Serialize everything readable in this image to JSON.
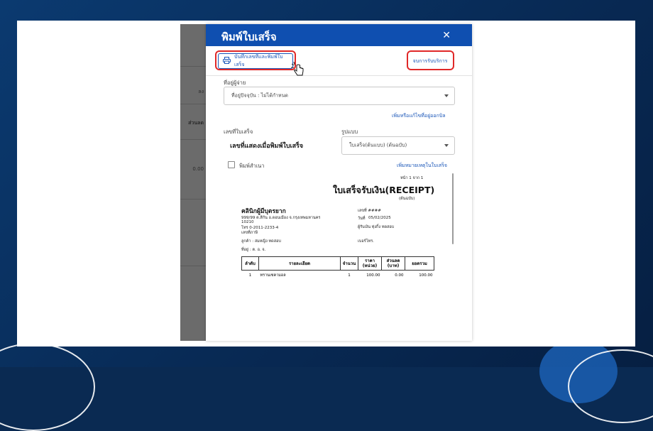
{
  "modal": {
    "title": "พิมพ์ใบเสร็จ",
    "close_icon": "close-icon"
  },
  "toolbar": {
    "save_print_label": "บันทึกเลขที่และพิมพ์ใบเสร็จ",
    "save_print_icon": "printer-icon",
    "end_service_label": "จบการรับบริการ"
  },
  "form": {
    "address_label": "ที่อยู่ผู้จ่าย",
    "address_value": "ที่อยู่ปัจจุบัน : ไม่ได้กำหนด",
    "add_address_link": "เพิ่มหรือแก้ไขที่อยู่ออกบิล",
    "receipt_no_label": "เลขที่ใบเสร็จ",
    "receipt_no_value": "เลขที่แสดงเมื่อพิมพ์ใบเสร็จ",
    "format_label": "รูปแบบ",
    "format_value": "ใบเสร็จ(ต้นแบบ) (ต้นฉบับ)",
    "copy_label": "พิมพ์สำเนา",
    "add_note_link": "เพิ่มหมายเหตุในใบเสร็จ"
  },
  "receipt": {
    "page": "หน้า 1 จาก 1",
    "title": "ใบเสร็จรับเงิน(RECEIPT)",
    "subtitle": "(ต้นฉบับ)",
    "clinic_name": "คลินิกผู้มีบุตรยาก",
    "address_line1": "999/99 ต.สีกัน อ.ดอนเมือง จ.กรุงเทพมหานคร",
    "address_line2": "10210",
    "phone": "โทร 0-2011-2233-4",
    "tax_id": "เลขที่ภาษี",
    "no_label": "เลขที่ ####",
    "date_label": "วันที่",
    "date_value": "05/02/2025",
    "receiver": "ผู้รับเงิน ทุ่งกิ้ง ทดสอบ",
    "customer": "ลูกค้า : สมหญิง ทดสอบ",
    "customer_phone": "เบอร์โทร.",
    "customer_address": "ที่อยู่ :   ต.  อ.  จ.",
    "columns": [
      "ลำดับ",
      "รายละเอียด",
      "จำนวน",
      "ราคา (หน่วย)",
      "ส่วนลด (บาท)",
      "ยอดรวม"
    ],
    "rows": [
      [
        "1",
        "ทรานเซคามอล",
        "1",
        "100.00",
        "0.00",
        "100.00"
      ]
    ]
  },
  "backdrop": {
    "label1": "ส่วนลด",
    "label2": "0.00",
    "label3": "ลง"
  }
}
